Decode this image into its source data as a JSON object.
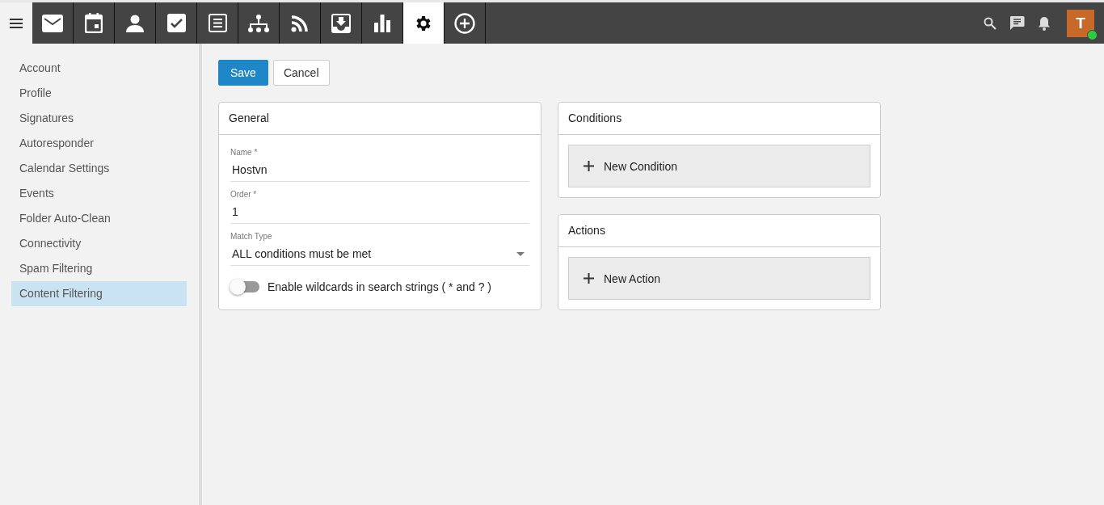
{
  "app_tabs": [
    {
      "kind": "mail",
      "selected": false
    },
    {
      "kind": "calendar",
      "selected": false
    },
    {
      "kind": "contacts",
      "selected": false
    },
    {
      "kind": "tasks",
      "selected": false
    },
    {
      "kind": "notes",
      "selected": false
    },
    {
      "kind": "hierarchy",
      "selected": false
    },
    {
      "kind": "rss",
      "selected": false
    },
    {
      "kind": "inbox",
      "selected": false
    },
    {
      "kind": "chart",
      "selected": false
    },
    {
      "kind": "settings",
      "selected": true
    },
    {
      "kind": "add",
      "selected": false
    }
  ],
  "user": {
    "initial": "T",
    "online": true
  },
  "sidebar": {
    "items": [
      {
        "label": "Account",
        "selected": false
      },
      {
        "label": "Profile",
        "selected": false
      },
      {
        "label": "Signatures",
        "selected": false
      },
      {
        "label": "Autoresponder",
        "selected": false
      },
      {
        "label": "Calendar Settings",
        "selected": false
      },
      {
        "label": "Events",
        "selected": false
      },
      {
        "label": "Folder Auto-Clean",
        "selected": false
      },
      {
        "label": "Connectivity",
        "selected": false
      },
      {
        "label": "Spam Filtering",
        "selected": false
      },
      {
        "label": "Content Filtering",
        "selected": true
      }
    ]
  },
  "buttons": {
    "save": "Save",
    "cancel": "Cancel"
  },
  "general": {
    "title": "General",
    "fields": [
      {
        "label": "Name *",
        "value": "Hostvn"
      },
      {
        "label": "Order *",
        "value": "1"
      }
    ],
    "match_type": {
      "label": "Match Type",
      "value": "ALL conditions must be met"
    },
    "wildcards": {
      "label": "Enable wildcards in search strings ( * and ? )",
      "on": false
    }
  },
  "conditions": {
    "title": "Conditions",
    "button": "New Condition"
  },
  "actions": {
    "title": "Actions",
    "button": "New Action"
  }
}
